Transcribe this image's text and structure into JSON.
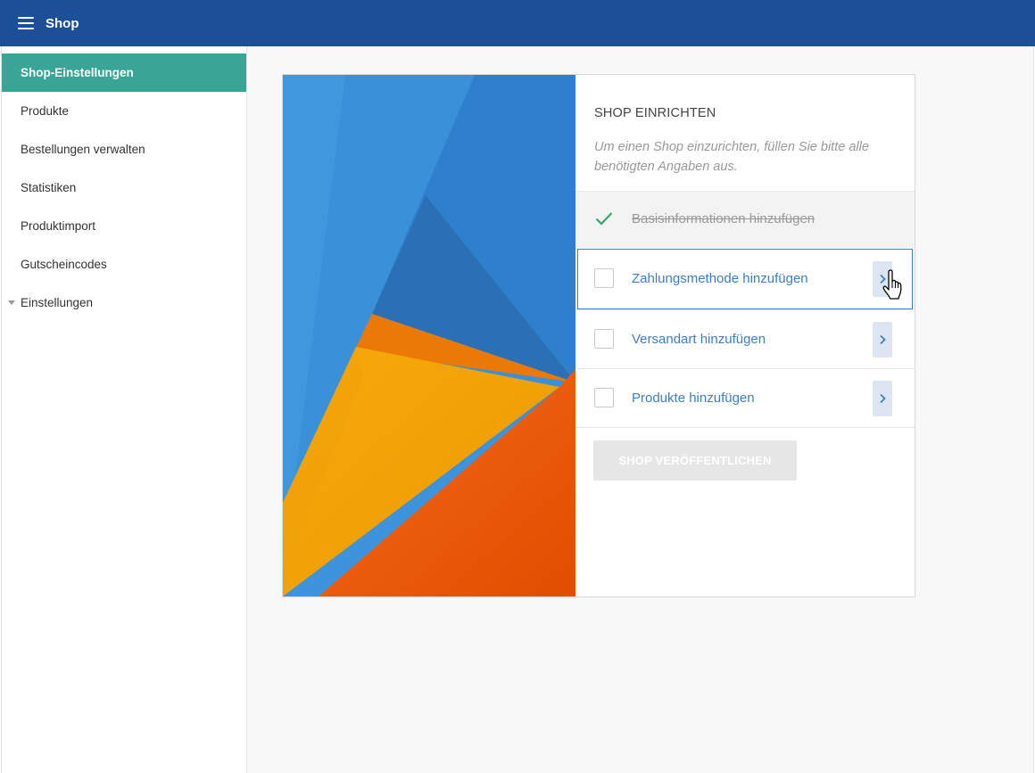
{
  "header": {
    "menu_icon": "hamburger-menu-icon",
    "title": "Shop",
    "background_color": "#1b5099"
  },
  "sidebar": {
    "active_color": "#38a597",
    "items": [
      {
        "label": "Shop-Einstellungen",
        "active": true
      },
      {
        "label": "Produkte",
        "active": false
      },
      {
        "label": "Bestellungen verwalten",
        "active": false
      },
      {
        "label": "Statistiken",
        "active": false
      },
      {
        "label": "Produktimport",
        "active": false
      },
      {
        "label": "Gutscheincodes",
        "active": false
      },
      {
        "label": "Einstellungen",
        "active": false,
        "icon": "caret-down-icon"
      }
    ]
  },
  "setup": {
    "title": "SHOP EINRICHTEN",
    "description": "Um einen Shop einzurichten, füllen Sie bitte alle benötigten Angaben aus.",
    "accent_color": "#3b7fc6",
    "steps": [
      {
        "label": "Basisinformationen hinzufügen",
        "completed": true,
        "icon": "checkmark-icon"
      },
      {
        "label": "Zahlungsmethode hinzufügen",
        "completed": false,
        "highlighted": true,
        "icon": "chevron-right-icon"
      },
      {
        "label": "Versandart hinzufügen",
        "completed": false,
        "icon": "chevron-right-icon"
      },
      {
        "label": "Produkte hinzufügen",
        "completed": false,
        "icon": "chevron-right-icon"
      }
    ],
    "publish_button": "SHOP VERÖFFENTLICHEN"
  },
  "cursor": {
    "icon": "hand-pointer-cursor-icon"
  }
}
